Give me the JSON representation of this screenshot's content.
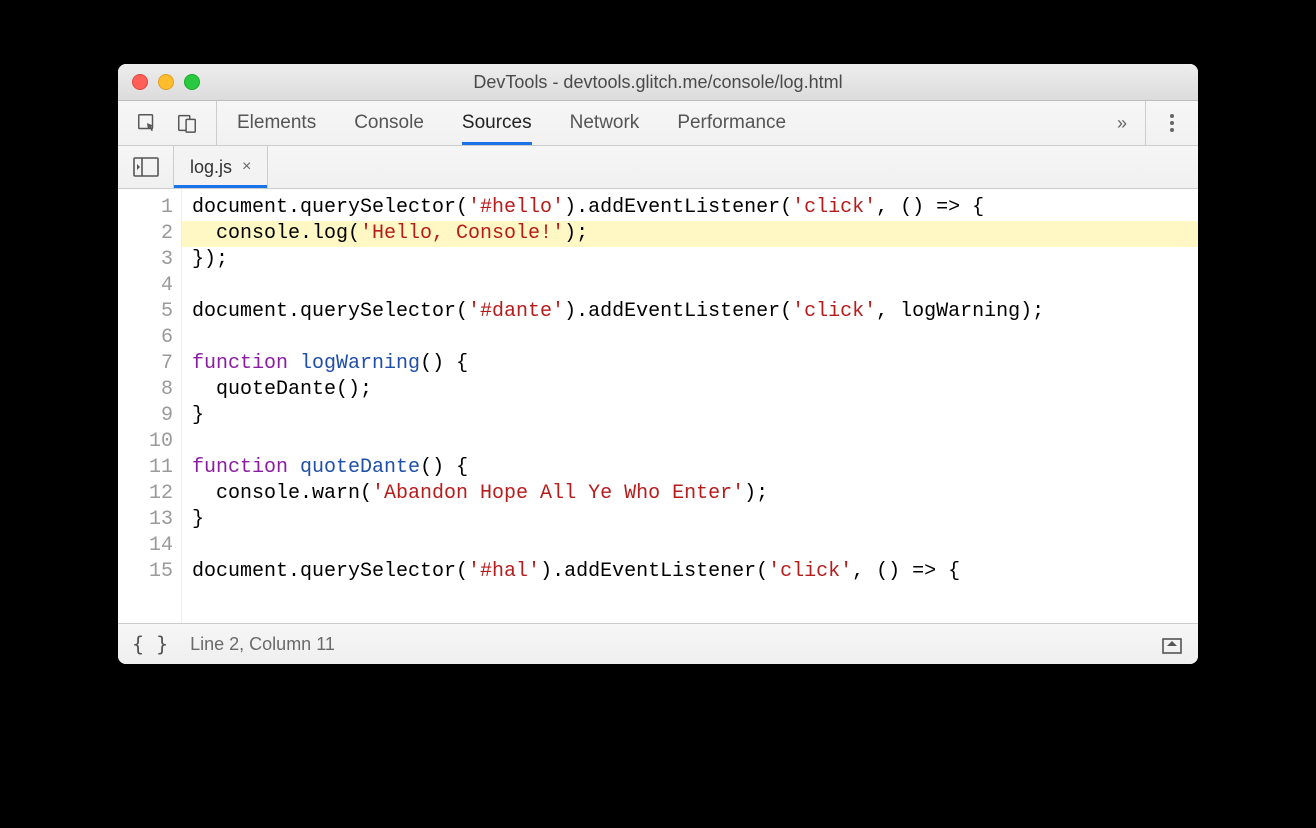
{
  "window": {
    "title": "DevTools - devtools.glitch.me/console/log.html"
  },
  "mainTabs": {
    "items": [
      "Elements",
      "Console",
      "Sources",
      "Network",
      "Performance"
    ],
    "activeIndex": 2,
    "overflowGlyph": "»"
  },
  "fileTabs": {
    "items": [
      {
        "name": "log.js",
        "close": "×"
      }
    ],
    "activeIndex": 0
  },
  "code": {
    "highlightedLine": 2,
    "lines": [
      [
        {
          "t": "document.querySelector("
        },
        {
          "t": "'#hello'",
          "c": "tok-str"
        },
        {
          "t": ").addEventListener("
        },
        {
          "t": "'click'",
          "c": "tok-str"
        },
        {
          "t": ", () => {"
        }
      ],
      [
        {
          "t": "  console.log("
        },
        {
          "t": "'Hello, Console!'",
          "c": "tok-str"
        },
        {
          "t": ");"
        }
      ],
      [
        {
          "t": "});"
        }
      ],
      [],
      [
        {
          "t": "document.querySelector("
        },
        {
          "t": "'#dante'",
          "c": "tok-str"
        },
        {
          "t": ").addEventListener("
        },
        {
          "t": "'click'",
          "c": "tok-str"
        },
        {
          "t": ", logWarning);"
        }
      ],
      [],
      [
        {
          "t": "function ",
          "c": "tok-kw"
        },
        {
          "t": "logWarning",
          "c": "tok-fn"
        },
        {
          "t": "() {"
        }
      ],
      [
        {
          "t": "  quoteDante();"
        }
      ],
      [
        {
          "t": "}"
        }
      ],
      [],
      [
        {
          "t": "function ",
          "c": "tok-kw"
        },
        {
          "t": "quoteDante",
          "c": "tok-fn"
        },
        {
          "t": "() {"
        }
      ],
      [
        {
          "t": "  console.warn("
        },
        {
          "t": "'Abandon Hope All Ye Who Enter'",
          "c": "tok-str"
        },
        {
          "t": ");"
        }
      ],
      [
        {
          "t": "}"
        }
      ],
      [],
      [
        {
          "t": "document.querySelector("
        },
        {
          "t": "'#hal'",
          "c": "tok-str"
        },
        {
          "t": ").addEventListener("
        },
        {
          "t": "'click'",
          "c": "tok-str"
        },
        {
          "t": ", () => {"
        }
      ]
    ]
  },
  "statusbar": {
    "pretty": "{ }",
    "position": "Line 2, Column 11"
  }
}
